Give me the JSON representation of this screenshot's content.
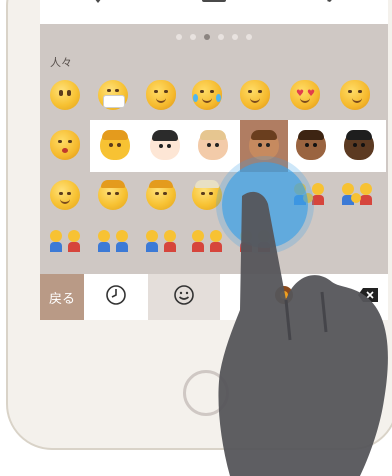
{
  "toolbar": {
    "icons": [
      "location-pin-icon",
      "camera-icon",
      "compose-icon"
    ]
  },
  "keyboard": {
    "page_dots": 6,
    "active_dot": 2,
    "category_label": "人々",
    "bottom_bar": {
      "back_label": "戻る"
    }
  },
  "colors": {
    "keyboard_bg": "#cfc8c4",
    "back_key": "#b99a86",
    "selected_tone": "#b07d62",
    "touch_ripple": "#3ca0e6",
    "hand": "#55555a"
  }
}
